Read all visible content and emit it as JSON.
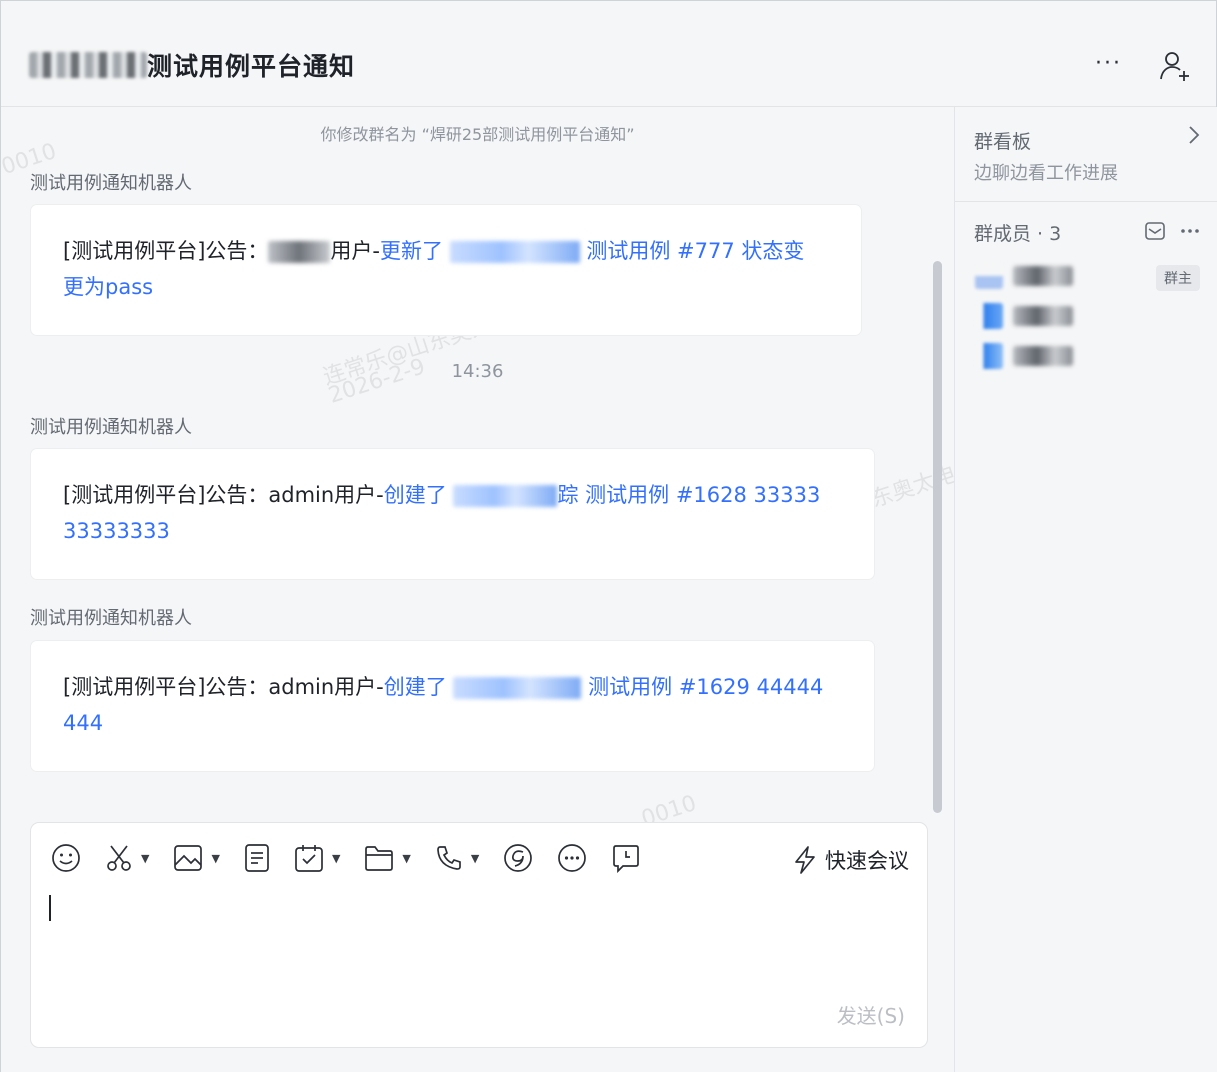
{
  "header": {
    "title": "测试用例平台通知",
    "more_label": "···"
  },
  "chat": {
    "system_notice": "你修改群名为 “焊研25部测试用例平台通知”",
    "timestamp": "14:36",
    "watermarks": [
      "连常乐@山东奥太",
      "2026-2-9",
      "东奥太电",
      "0010"
    ],
    "messages": [
      {
        "sender": "测试用例通知机器人",
        "prefix": "[测试用例平台]公告：",
        "user": "用户-",
        "action": "更新了",
        "case": "测试用例 #777 状态变",
        "case_line2": "更为pass"
      },
      {
        "sender": "测试用例通知机器人",
        "prefix": "[测试用例平台]公告：admin用户-",
        "action": "创建了",
        "tail_char": "踪",
        "case": "测试用例 #1628 33333",
        "case_line2": "33333333"
      },
      {
        "sender": "测试用例通知机器人",
        "prefix": "[测试用例平台]公告：admin用户-",
        "action": "创建了",
        "case": "测试用例 #1629 44444",
        "case_line2": "444"
      }
    ]
  },
  "composer": {
    "quick_meeting": "快速会议",
    "send_label": "发送(S)",
    "tools": [
      "emoji-icon",
      "scissors-icon",
      "image-icon",
      "doc-icon",
      "task-icon",
      "folder-icon",
      "phone-icon",
      "mention-icon",
      "more-icon",
      "schedule-icon"
    ]
  },
  "side": {
    "board_title": "群看板",
    "board_sub": "边聊边看工作进展",
    "members_title": "群成员 · 3",
    "owner_badge": "群主"
  },
  "colors": {
    "link": "#3370ff",
    "background": "#f5f6f7",
    "muted": "#8f959e"
  }
}
